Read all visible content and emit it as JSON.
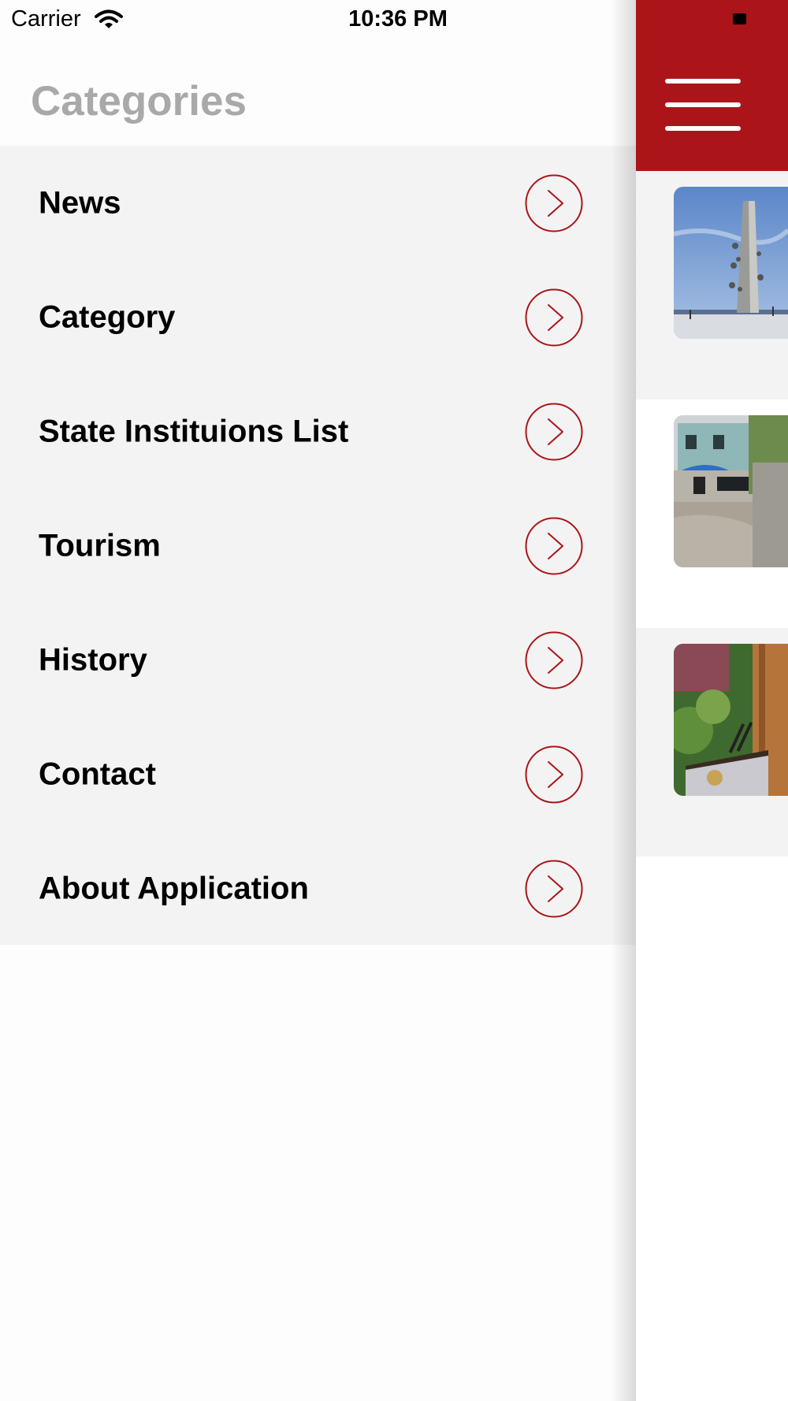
{
  "status_bar": {
    "carrier": "Carrier",
    "time": "10:36 PM"
  },
  "drawer": {
    "title": "Categories",
    "items": [
      {
        "label": "News"
      },
      {
        "label": "Category"
      },
      {
        "label": "State Instituions List"
      },
      {
        "label": "Tourism"
      },
      {
        "label": "History"
      },
      {
        "label": "Contact"
      },
      {
        "label": "About Application"
      }
    ]
  },
  "colors": {
    "accent": "#ab1519",
    "list_background": "#f3f3f3",
    "title_gray": "#a9a9a9"
  },
  "icons": {
    "menu": "hamburger-icon",
    "item_arrow": "chevron-right-circle-icon",
    "wifi": "wifi-icon",
    "battery": "battery-icon"
  },
  "news": [
    {
      "thumbnail": "monument-photo"
    },
    {
      "thumbnail": "flooded-street-photo"
    },
    {
      "thumbnail": "podium-speech-photo"
    }
  ]
}
